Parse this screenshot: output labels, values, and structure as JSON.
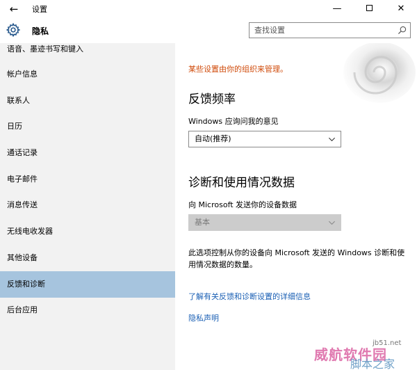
{
  "window": {
    "title": "设置",
    "back_icon": "←",
    "minimize": "—",
    "close": "✕"
  },
  "header": {
    "section_title": "隐私",
    "search_placeholder": "查找设置"
  },
  "sidebar": {
    "items": [
      {
        "label": "语音、墨迹书写和键入",
        "active": false
      },
      {
        "label": "帐户信息",
        "active": false
      },
      {
        "label": "联系人",
        "active": false
      },
      {
        "label": "日历",
        "active": false
      },
      {
        "label": "通话记录",
        "active": false
      },
      {
        "label": "电子邮件",
        "active": false
      },
      {
        "label": "消息传送",
        "active": false
      },
      {
        "label": "无线电收发器",
        "active": false
      },
      {
        "label": "其他设备",
        "active": false
      },
      {
        "label": "反馈和诊断",
        "active": true
      },
      {
        "label": "后台应用",
        "active": false
      }
    ]
  },
  "main": {
    "org_note": "某些设置由你的组织来管理。",
    "feedback": {
      "heading": "反馈频率",
      "label": "Windows 应询问我的意见",
      "value": "自动(推荐)"
    },
    "diagnostics": {
      "heading": "诊断和使用情况数据",
      "label": "向 Microsoft 发送你的设备数据",
      "value": "基本",
      "description": "此选项控制从你的设备向 Microsoft 发送的 Windows 诊断和使用情况数据的数量。"
    },
    "links": {
      "learn_more": "了解有关反馈和诊断设置的详细信息",
      "privacy": "隐私声明"
    }
  },
  "watermark": {
    "text": "威航软件园",
    "site": "jb51.net",
    "sub": "脚本之家"
  },
  "colors": {
    "sidebar_bg": "#f2f2f2",
    "active_item": "#a6c4de",
    "org_note": "#d04b0b",
    "link": "#1a5fb4"
  }
}
